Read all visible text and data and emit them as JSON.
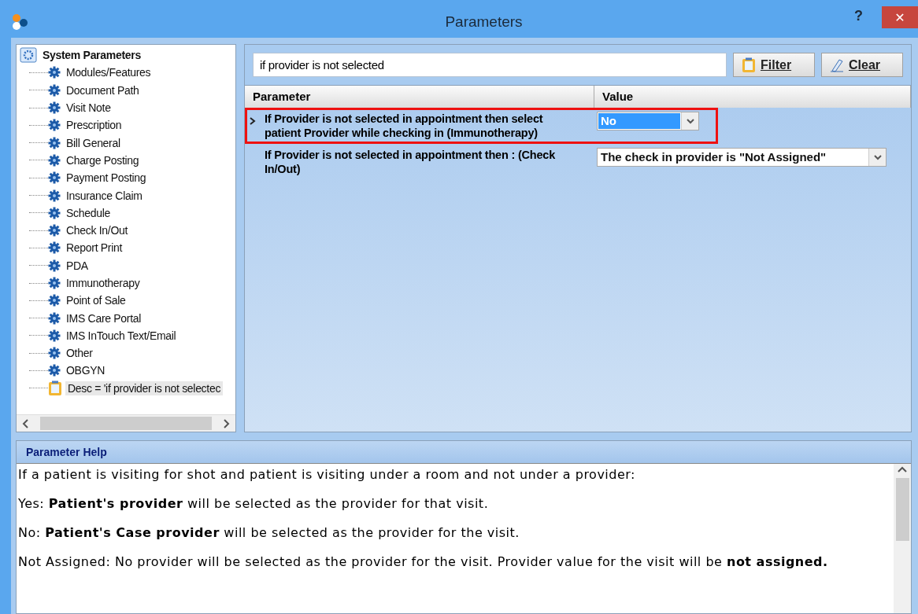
{
  "window": {
    "title": "Parameters",
    "help_button": "?",
    "close_button": "✕"
  },
  "tree": {
    "label": "System Parameters",
    "kind": "root",
    "selected": false,
    "children": [
      {
        "label": "Modules/Features",
        "kind": "category",
        "selected": false
      },
      {
        "label": "Document Path",
        "kind": "category",
        "selected": false
      },
      {
        "label": "Visit Note",
        "kind": "category",
        "selected": false
      },
      {
        "label": "Prescription",
        "kind": "category",
        "selected": false
      },
      {
        "label": "Bill General",
        "kind": "category",
        "selected": false
      },
      {
        "label": "Charge Posting",
        "kind": "category",
        "selected": false
      },
      {
        "label": "Payment Posting",
        "kind": "category",
        "selected": false
      },
      {
        "label": "Insurance Claim",
        "kind": "category",
        "selected": false
      },
      {
        "label": "Schedule",
        "kind": "category",
        "selected": false
      },
      {
        "label": "Check In/Out",
        "kind": "category",
        "selected": false
      },
      {
        "label": "Report Print",
        "kind": "category",
        "selected": false
      },
      {
        "label": "PDA",
        "kind": "category",
        "selected": false
      },
      {
        "label": "Immunotherapy",
        "kind": "category",
        "selected": false
      },
      {
        "label": "Point of Sale",
        "kind": "category",
        "selected": false
      },
      {
        "label": "IMS Care Portal",
        "kind": "category",
        "selected": false
      },
      {
        "label": "IMS InTouch Text/Email",
        "kind": "category",
        "selected": false
      },
      {
        "label": "Other",
        "kind": "category",
        "selected": false
      },
      {
        "label": "OBGYN",
        "kind": "category",
        "selected": false
      },
      {
        "label": "Desc = 'if provider is not selectec",
        "kind": "filter",
        "selected": true
      }
    ]
  },
  "filter": {
    "value": "if provider is not selected",
    "buttons": [
      {
        "label": "Filter",
        "kind": "filter"
      },
      {
        "label": "Clear",
        "kind": "clear"
      }
    ]
  },
  "table": {
    "columns": [
      "Parameter",
      "Value"
    ],
    "rows": [
      {
        "current": true,
        "outlined": true,
        "parameter": "If Provider is not selected in appointment then select patient Provider while checking in (Immunotherapy)",
        "value": "No",
        "value_selected": true
      },
      {
        "current": false,
        "outlined": false,
        "parameter": "If Provider is not selected in appointment then : (Check In/Out)",
        "value": "The check in provider is \"Not Assigned\"",
        "value_selected": false
      }
    ]
  },
  "help": {
    "title": "Parameter Help",
    "paragraphs": [
      "If a patient is visiting for shot and patient is visiting under a room and not under a provider:",
      "Yes: **Patient's provider** will be selected as the provider for that visit.",
      "No: **Patient's Case provider** will be selected as the provider for the visit.",
      "Not Assigned: No provider will be selected as the provider for the visit. Provider value for the visit will be **not assigned.**"
    ]
  }
}
